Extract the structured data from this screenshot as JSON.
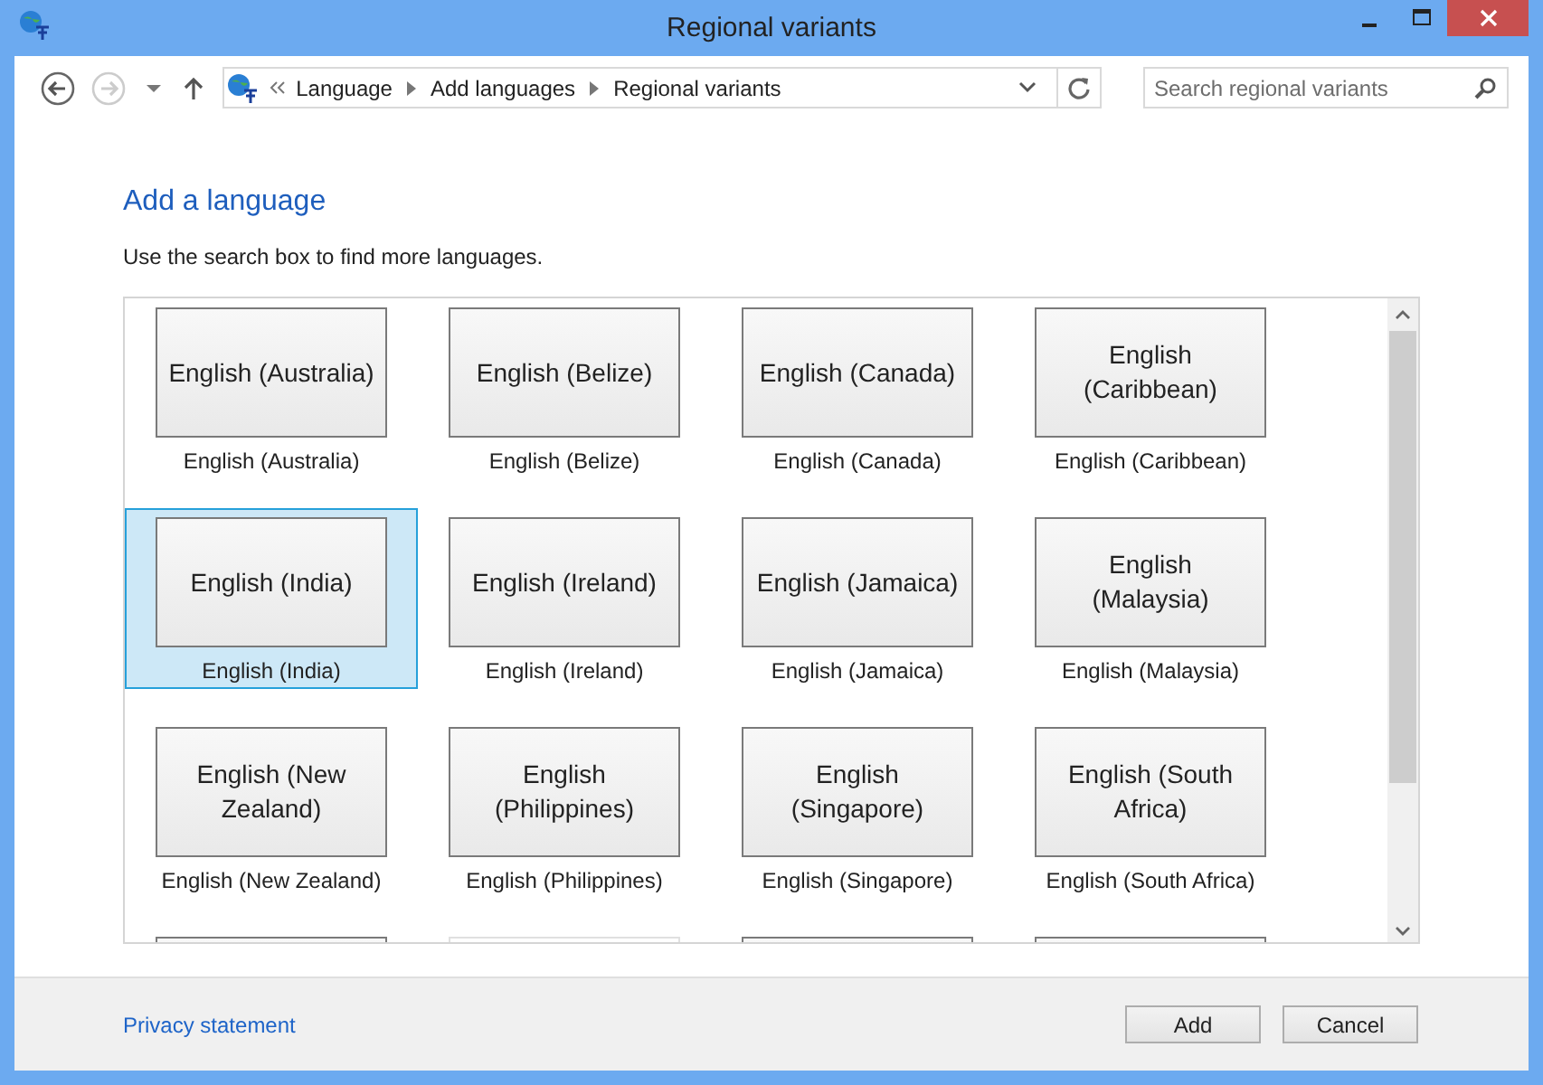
{
  "window": {
    "title": "Regional variants"
  },
  "address": {
    "crumbs": [
      "Language",
      "Add languages",
      "Regional variants"
    ]
  },
  "search": {
    "placeholder": "Search regional variants"
  },
  "heading": "Add a language",
  "instruction": "Use the search box to find more languages.",
  "languages": [
    {
      "tile": "English (Australia)",
      "caption": "English (Australia)",
      "selected": false
    },
    {
      "tile": "English (Belize)",
      "caption": "English (Belize)",
      "selected": false
    },
    {
      "tile": "English (Canada)",
      "caption": "English (Canada)",
      "selected": false
    },
    {
      "tile": "English (Caribbean)",
      "caption": "English (Caribbean)",
      "selected": false
    },
    {
      "tile": "English (India)",
      "caption": "English (India)",
      "selected": true
    },
    {
      "tile": "English (Ireland)",
      "caption": "English (Ireland)",
      "selected": false
    },
    {
      "tile": "English (Jamaica)",
      "caption": "English (Jamaica)",
      "selected": false
    },
    {
      "tile": "English (Malaysia)",
      "caption": "English (Malaysia)",
      "selected": false
    },
    {
      "tile": "English (New Zealand)",
      "caption": "English (New Zealand)",
      "selected": false
    },
    {
      "tile": "English (Philippines)",
      "caption": "English (Philippines)",
      "selected": false
    },
    {
      "tile": "English (Singapore)",
      "caption": "English (Singapore)",
      "selected": false
    },
    {
      "tile": "English (South Africa)",
      "caption": "English (South Africa)",
      "selected": false
    }
  ],
  "footer": {
    "link": "Privacy statement",
    "buttons": [
      "Add",
      "Cancel"
    ]
  }
}
